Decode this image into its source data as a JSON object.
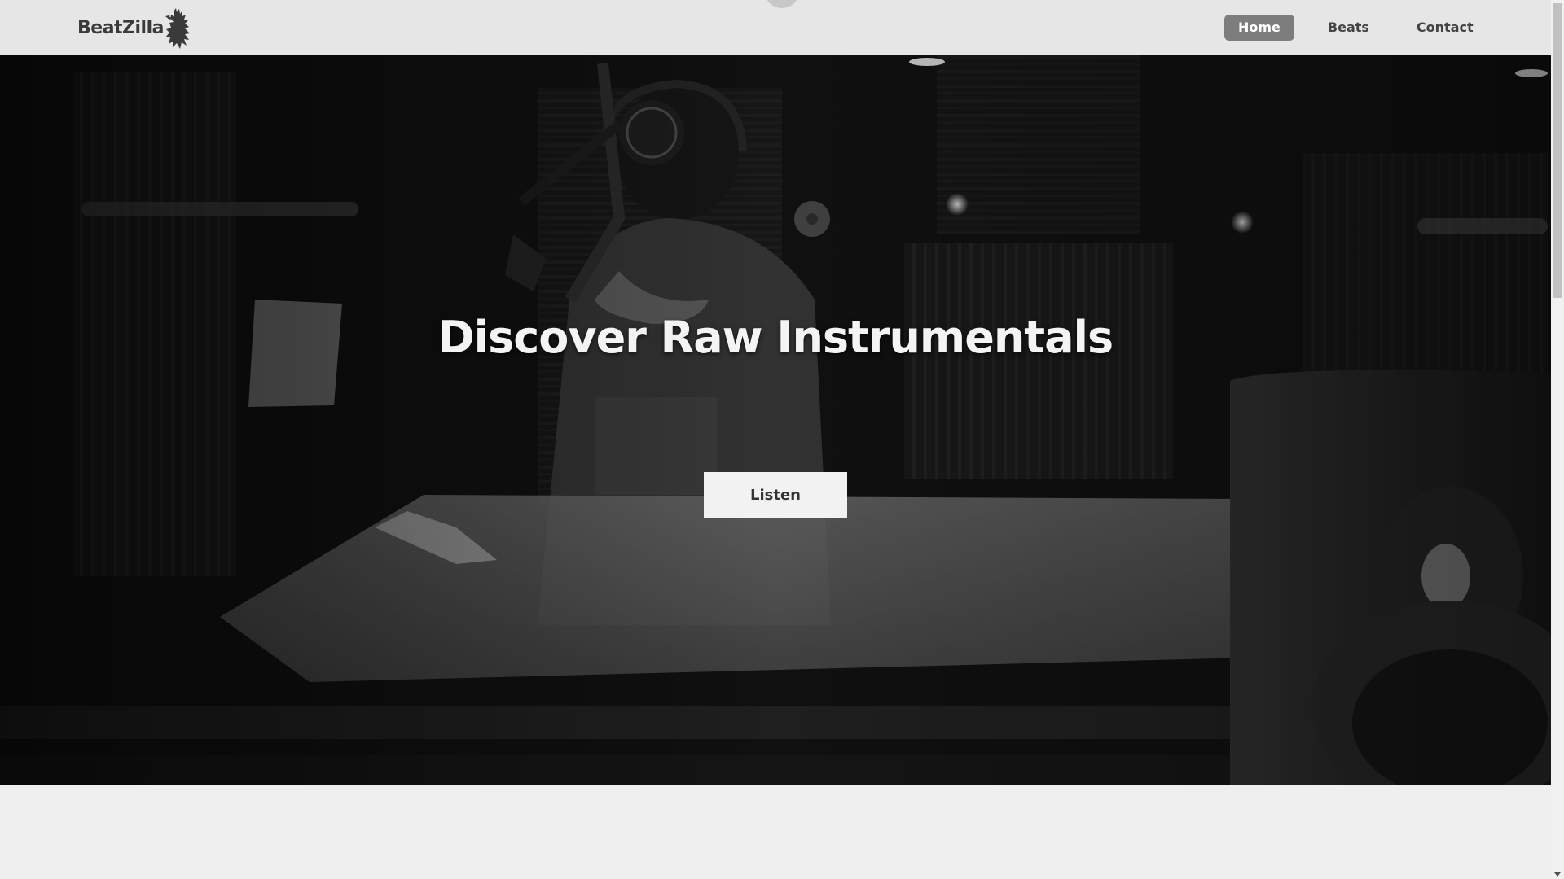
{
  "header": {
    "logo_text": "BeatZilla",
    "logo_icon": "godzilla-mascot-icon"
  },
  "nav": {
    "items": [
      {
        "label": "Home",
        "active": true
      },
      {
        "label": "Beats",
        "active": false
      },
      {
        "label": "Contact",
        "active": false
      }
    ]
  },
  "hero": {
    "title": "Discover Raw Instrumentals",
    "cta_label": "Listen",
    "background": "recording-studio-photo-black-and-white"
  },
  "colors": {
    "header_bg": "#e6e6e6",
    "active_nav_bg": "#7d7d7d",
    "page_bg": "#efefef",
    "button_bg": "#f2f2f2"
  }
}
